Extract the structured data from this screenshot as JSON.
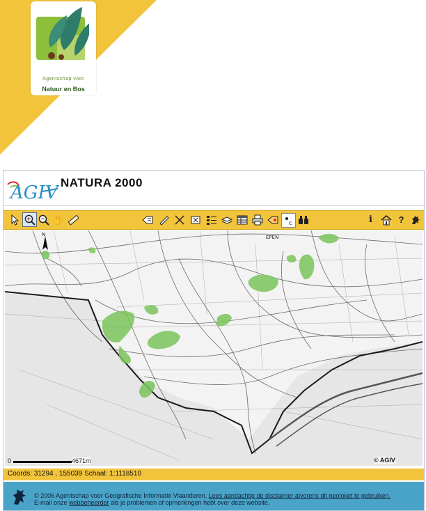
{
  "header": {
    "logo_line1": "Agentschap voor",
    "logo_line2": "Natuur en Bos",
    "accent_color": "#f2c43c"
  },
  "app": {
    "brand": "AGIV",
    "title": "NATURA 2000"
  },
  "toolbar": {
    "left_tools": [
      "select-icon",
      "zoom-in-icon",
      "zoom-out-icon",
      "pan-icon",
      "measure-icon"
    ],
    "mid_tools": [
      "identify-icon",
      "draw-icon",
      "edit-icon",
      "delete-icon",
      "legend-icon",
      "layers-icon",
      "table-icon",
      "print-icon",
      "highlight-icon",
      "label-icon",
      "binoculars-icon"
    ],
    "right_tools": [
      "info-icon",
      "home-icon",
      "help-icon",
      "flemish-lion-icon"
    ],
    "selected_tool": "zoom-in-icon"
  },
  "map": {
    "scale_zero": "0",
    "scale_label": "4671m",
    "copyright": "© AGIV",
    "place_label": "EPEN",
    "natura_color": "#7cc55c"
  },
  "status": {
    "coords_text": "Coords: 31294 , 155039 Schaal: 1:1118510"
  },
  "footer": {
    "line1_prefix": "© 2006 Agentschap voor Geografische Informatie Vlaanderen. ",
    "disclaimer_link": "Lees aandachtig de disclaimer alvorens dit geoloket te gebruiken.",
    "line2_prefix": "E-mail onze ",
    "webmaster_link": "webbeheerder",
    "line2_suffix": " als je problemen of opmerkingen hebt over deze website."
  }
}
